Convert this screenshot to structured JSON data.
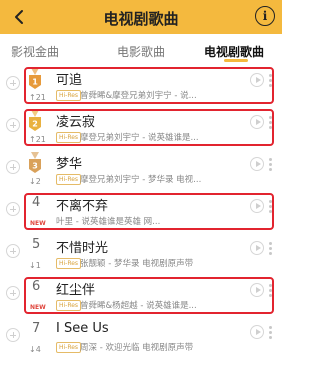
{
  "header": {
    "title": "电视剧歌曲",
    "info_glyph": "i"
  },
  "tabs": [
    {
      "label": "影视金曲"
    },
    {
      "label": "电影歌曲"
    },
    {
      "label": "电视剧歌曲"
    }
  ],
  "songs": [
    {
      "rank": "1",
      "change": "↑21",
      "medal": true,
      "medal_color": "#e79a3b",
      "title": "可追",
      "hires": "Hi-Res",
      "subtitle": "曾舜晞&摩登兄弟刘宇宁 - 说...",
      "highlighted": true
    },
    {
      "rank": "2",
      "change": "↑21",
      "medal": true,
      "medal_color": "#e9b13f",
      "title": "凌云寂",
      "hires": "Hi-Res",
      "subtitle": "摩登兄弟刘宇宁 - 说英雄谁是...",
      "highlighted": true
    },
    {
      "rank": "3",
      "change": "↓2",
      "medal": true,
      "medal_color": "#d9a15a",
      "title": "梦华",
      "hires": "Hi-Res",
      "subtitle": "摩登兄弟刘宇宁 - 梦华录 电视...",
      "highlighted": false
    },
    {
      "rank": "4",
      "change": "NEW",
      "medal": false,
      "title": "不离不弃",
      "hires": "",
      "subtitle": "叶里 - 说英雄谁是英雄 网...",
      "highlighted": true
    },
    {
      "rank": "5",
      "change": "↓1",
      "medal": false,
      "title": "不惜时光",
      "hires": "Hi-Res",
      "subtitle": "张靓颖 - 梦华录 电视剧原声带",
      "highlighted": false
    },
    {
      "rank": "6",
      "change": "NEW",
      "medal": false,
      "title": "红尘伴",
      "hires": "Hi-Res",
      "subtitle": "曾舜晞&杨超越 - 说英雄谁是...",
      "highlighted": true
    },
    {
      "rank": "7",
      "change": "↓4",
      "medal": false,
      "title": "I See Us",
      "hires": "Hi-Res",
      "subtitle": "周深 - 欢迎光临 电视剧原声带",
      "highlighted": false
    }
  ]
}
